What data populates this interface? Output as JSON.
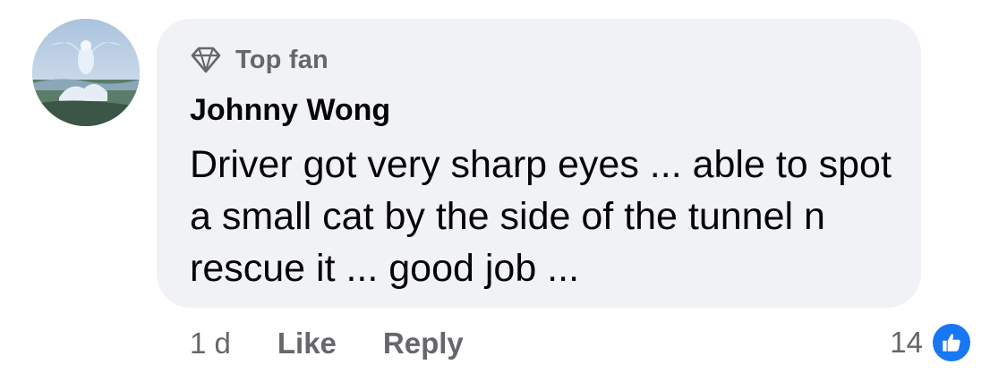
{
  "comment": {
    "badge_label": "Top fan",
    "author": "Johnny Wong",
    "text": "Driver got very sharp eyes ... able to spot a small cat by the side of the tunnel n rescue it ... good job ...",
    "timestamp": "1 d",
    "like_label": "Like",
    "reply_label": "Reply",
    "reaction_count": "14"
  },
  "icons": {
    "badge": "diamond-icon",
    "reaction": "thumbs-up-icon",
    "avatar": "avatar-image"
  },
  "colors": {
    "bubble_bg": "#f0f2f5",
    "meta_text": "#65676b",
    "body_text": "#050505",
    "like_blue": "#1877f2"
  }
}
